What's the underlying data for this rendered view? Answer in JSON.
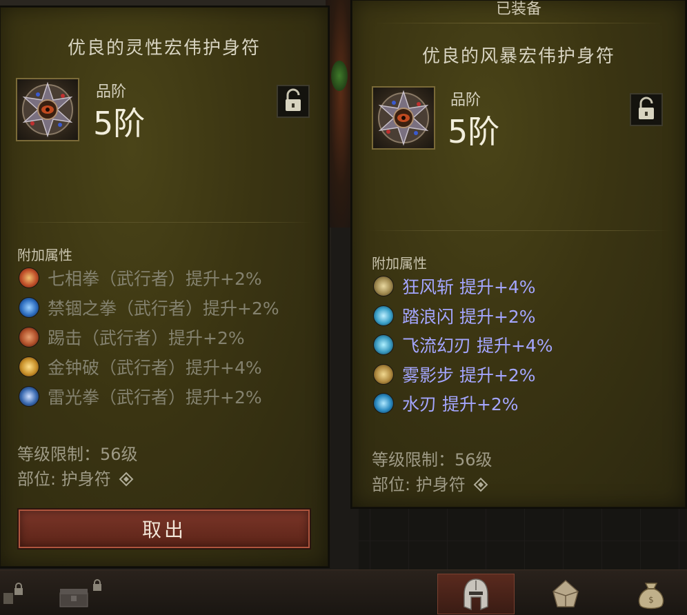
{
  "left_item": {
    "name": "优良的灵性宏伟护身符",
    "grade_label": "品阶",
    "grade_value": "5阶",
    "lock_icon": "unlocked-padlock-icon",
    "affix_header": "附加属性",
    "affixes": [
      {
        "text": "七相拳（武行者）提升+2%",
        "icon": "seven-sided-strike-icon",
        "color": "#c0502a"
      },
      {
        "text": "禁锢之拳（武行者）提升+2%",
        "icon": "binding-fist-icon",
        "color": "#2f6fc0"
      },
      {
        "text": "踢击（武行者）提升+2%",
        "icon": "kick-icon",
        "color": "#b0502a"
      },
      {
        "text": "金钟破（武行者）提升+4%",
        "icon": "golden-bell-icon",
        "color": "#c8902a"
      },
      {
        "text": "雷光拳（武行者）提升+2%",
        "icon": "thunder-fist-icon",
        "color": "#3a6ab0"
      }
    ],
    "level_req": "等级限制：56级",
    "slot": "部位: 护身符",
    "take_out_label": "取出"
  },
  "right_item": {
    "equipped_label": "已装备",
    "name": "优良的风暴宏伟护身符",
    "grade_label": "品阶",
    "grade_value": "5阶",
    "lock_icon": "unlocked-padlock-icon",
    "affix_header": "附加属性",
    "affixes": [
      {
        "text": "狂风斩  提升+4%",
        "icon": "gale-slash-icon",
        "color": "#a08a50"
      },
      {
        "text": "踏浪闪  提升+2%",
        "icon": "wave-step-icon",
        "color": "#3aa0c8"
      },
      {
        "text": "飞流幻刃  提升+4%",
        "icon": "flowing-blade-icon",
        "color": "#3a9ac0"
      },
      {
        "text": "雾影步  提升+2%",
        "icon": "mist-step-icon",
        "color": "#b08a40"
      },
      {
        "text": "水刃  提升+2%",
        "icon": "water-blade-icon",
        "color": "#2a8ac0"
      }
    ],
    "level_req": "等级限制：56级",
    "slot": "部位: 护身符"
  },
  "colors": {
    "panel_bg": "#3a3412",
    "affix_inactive": "#84826f",
    "affix_active": "#a4a6ff",
    "button_red": "#6a2c20"
  },
  "bottom_tabs": [
    {
      "icon": "locked-slot-icon",
      "active": false
    },
    {
      "icon": "locked-chest-icon",
      "active": false
    },
    {
      "icon": "helmet-icon",
      "active": true
    },
    {
      "icon": "gem-pouch-icon",
      "active": false
    },
    {
      "icon": "money-bag-icon",
      "active": false
    }
  ]
}
